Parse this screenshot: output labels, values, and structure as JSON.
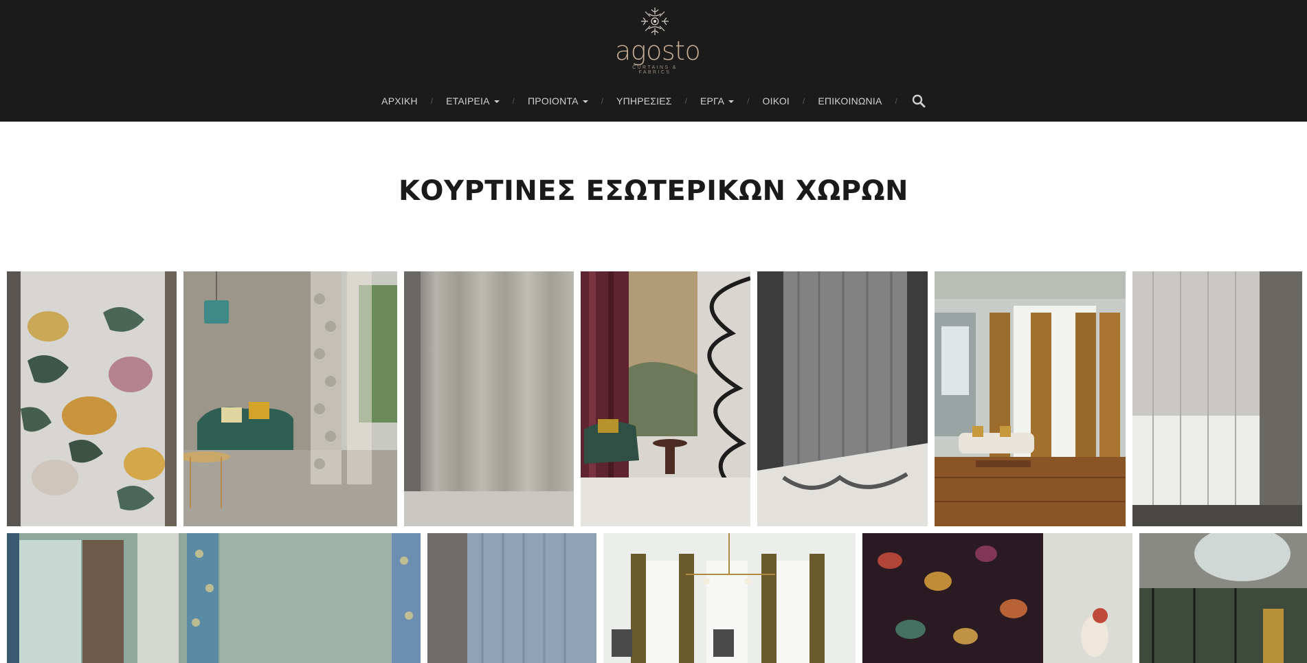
{
  "brand": {
    "name": "agosto",
    "tagline": "CURTAINS & FABRICS"
  },
  "nav": {
    "items": [
      {
        "label": "ΑΡΧΙΚΗ",
        "dropdown": false
      },
      {
        "label": "ΕΤΑΙΡΕΙΑ",
        "dropdown": true
      },
      {
        "label": "ΠΡΟΙΟΝΤΑ",
        "dropdown": true
      },
      {
        "label": "ΥΠΗΡΕΣΙΕΣ",
        "dropdown": false
      },
      {
        "label": "ΕΡΓΑ",
        "dropdown": true
      },
      {
        "label": "ΟΙΚΟΙ",
        "dropdown": false
      },
      {
        "label": "ΕΠΙΚΟΙΝΩΝΙΑ",
        "dropdown": false
      }
    ],
    "separator": "/",
    "search_icon": "search-icon"
  },
  "page": {
    "title": "ΚΟΥΡΤΙΝΕΣ ΕΣΩΤΕΡΙΚΩΝ ΧΩΡΩΝ"
  },
  "colors": {
    "header_bg": "#1b1b1b",
    "logo_gold": "#c6ae95",
    "nav_text": "#d2d2d2"
  }
}
